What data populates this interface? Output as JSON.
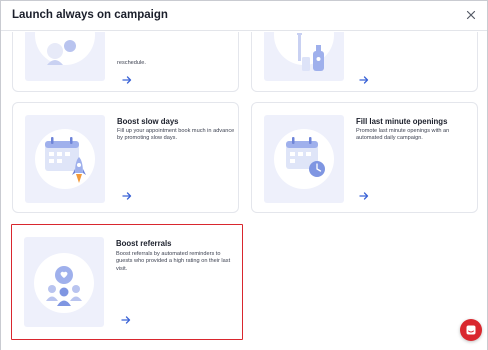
{
  "dialog": {
    "title": "Launch always on campaign"
  },
  "cards": [
    {
      "title": "",
      "description": "reschedule.",
      "illustration": "reminder-illustration"
    },
    {
      "title": "",
      "description": "",
      "illustration": "products-illustration"
    },
    {
      "title": "Boost slow days",
      "description": "Fill up your appointment book much in advance by promoting slow days.",
      "illustration": "calendar-rocket-illustration"
    },
    {
      "title": "Fill last minute openings",
      "description": "Promote last minute openings with an automated daily campaign.",
      "illustration": "calendar-clock-illustration"
    },
    {
      "title": "Boost referrals",
      "description": "Boost referrals by automated reminders to guests who provided a high rating on their last visit.",
      "illustration": "people-heart-illustration"
    }
  ],
  "colors": {
    "accent": "#3b63d6",
    "selected_border": "#d9272e",
    "illustration_bg": "#eef0fb",
    "chat_button": "#d9272e"
  }
}
